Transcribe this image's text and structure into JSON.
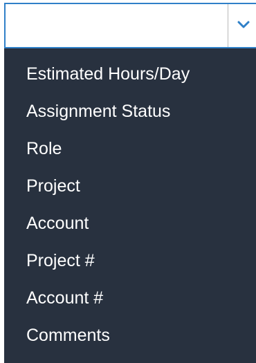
{
  "select": {
    "value": "",
    "dropdown_icon": "chevron-down-icon"
  },
  "menu": {
    "items": [
      {
        "label": "Estimated Hours/Day"
      },
      {
        "label": "Assignment Status"
      },
      {
        "label": "Role"
      },
      {
        "label": "Project"
      },
      {
        "label": "Account"
      },
      {
        "label": "Project #"
      },
      {
        "label": "Account #"
      },
      {
        "label": "Comments"
      }
    ]
  },
  "colors": {
    "accent": "#2f80c8",
    "dropdown_bg": "#28313f",
    "text": "#ffffff"
  }
}
